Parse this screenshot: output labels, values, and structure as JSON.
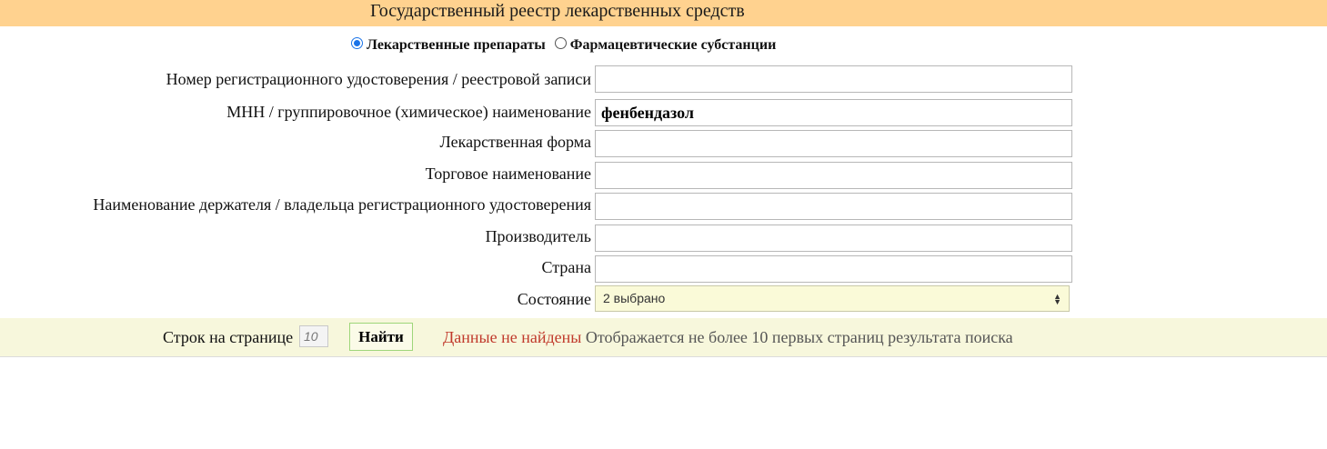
{
  "header": {
    "title": "Государственный реестр лекарственных средств",
    "bg_color": "#ffd28f"
  },
  "type_switch": {
    "options": [
      {
        "label": "Лекарственные препараты",
        "checked": true
      },
      {
        "label": "Фармацевтические субстанции",
        "checked": false
      }
    ]
  },
  "form": {
    "fields": [
      {
        "label": "Номер регистрационного удостоверения / реестровой записи",
        "value": ""
      },
      {
        "label": "МНН / группировочное (химическое) наименование",
        "value": "фенбендазол"
      },
      {
        "label": "Лекарственная форма",
        "value": ""
      },
      {
        "label": "Торговое наименование",
        "value": ""
      },
      {
        "label": "Наименование держателя / владельца регистрационного удостоверения",
        "value": ""
      },
      {
        "label": "Производитель",
        "value": ""
      },
      {
        "label": "Страна",
        "value": ""
      }
    ],
    "state": {
      "label": "Состояние",
      "selected": "2 выбрано"
    }
  },
  "footer": {
    "rows_label": "Строк на странице",
    "rows_placeholder": "10",
    "find_label": "Найти",
    "status_not_found": "Данные не найдены",
    "status_note": "Отображается не более 10 первых страниц результата поиска",
    "status_color": "#c0392b",
    "bg_color": "#f7f7dc"
  }
}
